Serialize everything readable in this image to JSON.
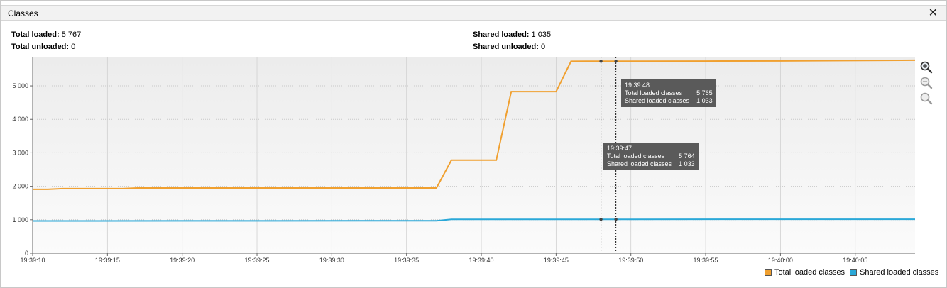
{
  "window": {
    "title": "Classes"
  },
  "stats": {
    "total_loaded_label": "Total loaded:",
    "total_loaded_value": "5 767",
    "total_unloaded_label": "Total unloaded:",
    "total_unloaded_value": "0",
    "shared_loaded_label": "Shared loaded:",
    "shared_loaded_value": "1 035",
    "shared_unloaded_label": "Shared unloaded:",
    "shared_unloaded_value": "0"
  },
  "tooltips": [
    {
      "time": "19:39:48",
      "total_label": "Total loaded classes",
      "total_value": "5 765",
      "shared_label": "Shared loaded classes",
      "shared_value": "1 033"
    },
    {
      "time": "19:39:47",
      "total_label": "Total loaded classes",
      "total_value": "5 764",
      "shared_label": "Shared loaded classes",
      "shared_value": "1 033"
    }
  ],
  "legend": {
    "total_label": "Total loaded classes",
    "shared_label": "Shared loaded classes"
  },
  "colors": {
    "total": "#f0a030",
    "shared": "#2aa8d8",
    "tooltip_bg": "#5a5a5a",
    "plot_bg_top": "#ececec"
  },
  "icons": [
    "zoom-in-icon",
    "zoom-reset-icon",
    "zoom-out-icon",
    "close-icon"
  ],
  "chart_data": {
    "type": "line",
    "title": "",
    "xlabel": "",
    "ylabel": "",
    "x_start": "19:39:10",
    "x_tick_labels": [
      "19:39:10",
      "19:39:15",
      "19:39:20",
      "19:39:25",
      "19:39:30",
      "19:39:35",
      "19:39:40",
      "19:39:45",
      "19:39:50",
      "19:39:55",
      "19:40:00",
      "19:40:05"
    ],
    "y_tick_labels": [
      "0",
      "1 000",
      "2 000",
      "3 000",
      "4 000",
      "5 000"
    ],
    "y_ticks": [
      0,
      1000,
      2000,
      3000,
      4000,
      5000
    ],
    "xlim_seconds": [
      0,
      59
    ],
    "ylim": [
      0,
      5870
    ],
    "grid": true,
    "legend_position": "bottom-right",
    "cursor_times": [
      "19:39:48",
      "19:39:49"
    ],
    "series": [
      {
        "name": "Total loaded classes",
        "points": [
          [
            "19:39:10",
            1910
          ],
          [
            "19:39:11",
            1910
          ],
          [
            "19:39:12",
            1930
          ],
          [
            "19:39:16",
            1930
          ],
          [
            "19:39:17",
            1950
          ],
          [
            "19:39:37",
            1950
          ],
          [
            "19:39:38",
            2780
          ],
          [
            "19:39:41",
            2780
          ],
          [
            "19:39:42",
            4830
          ],
          [
            "19:39:45",
            4830
          ],
          [
            "19:39:46",
            5735
          ],
          [
            "19:39:47",
            5736
          ],
          [
            "19:39:48",
            5737
          ],
          [
            "19:39:55",
            5740
          ],
          [
            "19:40:00",
            5745
          ],
          [
            "19:40:09",
            5767
          ]
        ]
      },
      {
        "name": "Shared loaded classes",
        "points": [
          [
            "19:39:10",
            965
          ],
          [
            "19:39:37",
            970
          ],
          [
            "19:39:38",
            1010
          ],
          [
            "19:39:48",
            1012
          ],
          [
            "19:40:09",
            1015
          ]
        ]
      }
    ]
  }
}
